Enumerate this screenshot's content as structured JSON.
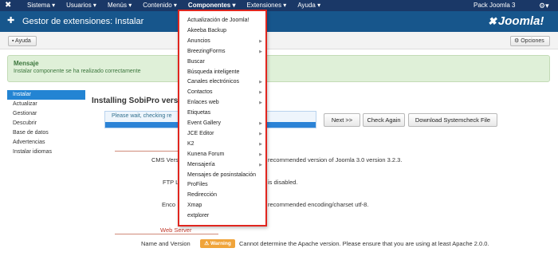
{
  "topnav": {
    "menu": [
      "Sistema",
      "Usuarios",
      "Menús",
      "Contenido",
      "Componentes",
      "Extensiones",
      "Ayuda"
    ],
    "active_index": 4,
    "site_label": "Pack Joomla 3"
  },
  "header": {
    "title": "Gestor de extensiones: Instalar",
    "brand": "Joomla!"
  },
  "toolbar": {
    "help_label": "Ayuda",
    "options_label": "Opciones"
  },
  "message": {
    "title": "Mensaje",
    "text": "Instalar componente se ha realizado correctamente"
  },
  "sidebar": {
    "items": [
      "Instalar",
      "Actualizar",
      "Gestionar",
      "Descubrir",
      "Base de datos",
      "Advertencias",
      "Instalar idiomas"
    ],
    "active_index": 0
  },
  "main": {
    "title": "Installing SobiPro versio",
    "progress_text": "Please wait, checking re",
    "progress_fraction": 1.0,
    "buttons": {
      "next": "Next >>",
      "check_again": "Check Again",
      "download": "Download Systemcheck File"
    },
    "requirements": [
      {
        "label": "CMS Versio",
        "text": "recommended version of Joomla 3.0 version 3.2.3."
      },
      {
        "label": "FTP L",
        "text": "is disabled."
      },
      {
        "label": "Enco",
        "text": "recommended encoding/charset utf-8."
      }
    ],
    "web_server": {
      "heading": "Web Server",
      "label": "Name and Version",
      "badge": "Warning",
      "text": "Cannot determine the Apache version. Please ensure that you are using at least Apache 2.0.0."
    }
  },
  "dropdown": {
    "items": [
      {
        "label": "Actualización de Joomla!",
        "submenu": false
      },
      {
        "label": "Akeeba Backup",
        "submenu": false
      },
      {
        "label": "Anuncios",
        "submenu": true
      },
      {
        "label": "BreezingForms",
        "submenu": true
      },
      {
        "label": "Buscar",
        "submenu": false
      },
      {
        "label": "Búsqueda inteligente",
        "submenu": false
      },
      {
        "label": "Canales electrónicos",
        "submenu": true
      },
      {
        "label": "Contactos",
        "submenu": true
      },
      {
        "label": "Enlaces web",
        "submenu": true
      },
      {
        "label": "Etiquetas",
        "submenu": false
      },
      {
        "label": "Event Gallery",
        "submenu": true
      },
      {
        "label": "JCE Editor",
        "submenu": true
      },
      {
        "label": "K2",
        "submenu": true
      },
      {
        "label": "Kunena Forum",
        "submenu": true
      },
      {
        "label": "Mensajería",
        "submenu": true
      },
      {
        "label": "Mensajes de posinstalación",
        "submenu": false
      },
      {
        "label": "ProFiles",
        "submenu": false
      },
      {
        "label": "Redirección",
        "submenu": false
      },
      {
        "label": "Xmap",
        "submenu": false
      },
      {
        "label": "extplorer",
        "submenu": false
      }
    ]
  },
  "colors": {
    "navbar": "#1a3867",
    "header": "#17568c",
    "active_blue": "#2384d3",
    "success_bg": "#dff0d8",
    "warning": "#f0a43a",
    "highlight_border": "#e0261f"
  },
  "icons": {
    "joomla": "joomla-logo-icon",
    "gear": "gear-icon",
    "puzzle": "puzzle-icon",
    "help": "help-icon",
    "warning": "warning-icon",
    "chevron": "chevron-right-icon"
  }
}
